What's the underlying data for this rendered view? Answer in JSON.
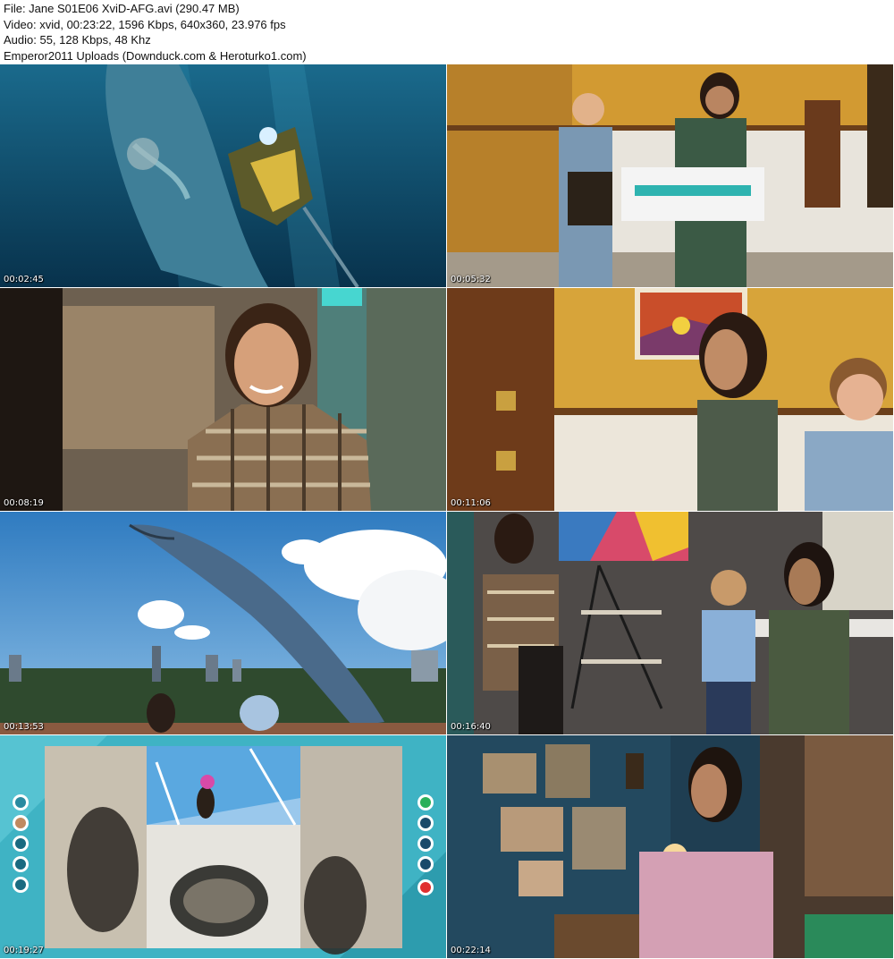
{
  "header": {
    "file_line": "File: Jane S01E06 XviD-AFG.avi (290.47 MB)",
    "video_line": "Video: xvid, 00:23:22, 1596 Kbps, 640x360, 23.976 fps",
    "audio_line": "Audio: 55, 128 Kbps, 48 Khz",
    "uploader_line": "Emperor2011 Uploads (Downduck.com & Heroturko1.com)"
  },
  "thumbnails": [
    {
      "timestamp": "00:02:45",
      "scene": "underwater-whale-submersible"
    },
    {
      "timestamp": "00:05:32",
      "scene": "hallway-kids-laundry-basket"
    },
    {
      "timestamp": "00:08:19",
      "scene": "smiling-woman-plaid-shirt"
    },
    {
      "timestamp": "00:11:06",
      "scene": "girl-boy-yellow-hallway"
    },
    {
      "timestamp": "00:13:53",
      "scene": "whale-over-city-skyline"
    },
    {
      "timestamp": "00:16:40",
      "scene": "woman-kids-kitchen"
    },
    {
      "timestamp": "00:19:27",
      "scene": "video-call-boat-ropes"
    },
    {
      "timestamp": "00:22:14",
      "scene": "girl-bedroom-lamp"
    }
  ],
  "colors": {
    "ocean": "#0e4a6b",
    "yellow_wall": "#d9a330",
    "sky": "#3d87c8",
    "call_frame": "#3fb3c4"
  }
}
